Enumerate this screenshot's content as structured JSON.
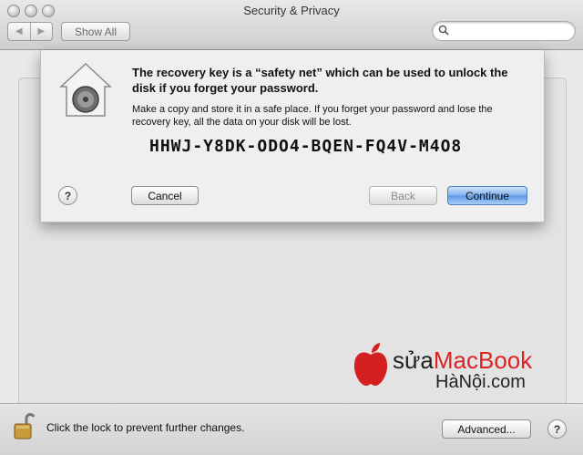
{
  "window": {
    "title": "Security & Privacy",
    "show_all_label": "Show All",
    "back_arrow": "◀",
    "forward_arrow": "▶"
  },
  "search": {
    "placeholder": "",
    "value": ""
  },
  "sheet": {
    "heading": "The recovery key is a “safety net” which can be used to unlock the disk if you forget your password.",
    "body": "Make a copy and store it in a safe place. If you forget your password and lose the recovery key, all the data on your disk will be lost.",
    "recovery_key": "HHWJ-Y8DK-ODO4-BQEN-FQ4V-M4O8",
    "help_label": "?",
    "cancel_label": "Cancel",
    "back_label": "Back",
    "continue_label": "Continue"
  },
  "footer": {
    "lock_text": "Click the lock to prevent further changes.",
    "advanced_label": "Advanced...",
    "help_label": "?"
  },
  "watermark": {
    "prefix": "sửa",
    "brand": "MacBook",
    "line2": "HàNội.com"
  },
  "colors": {
    "accent": "#5a98e6",
    "watermark_red": "#dd2222"
  }
}
